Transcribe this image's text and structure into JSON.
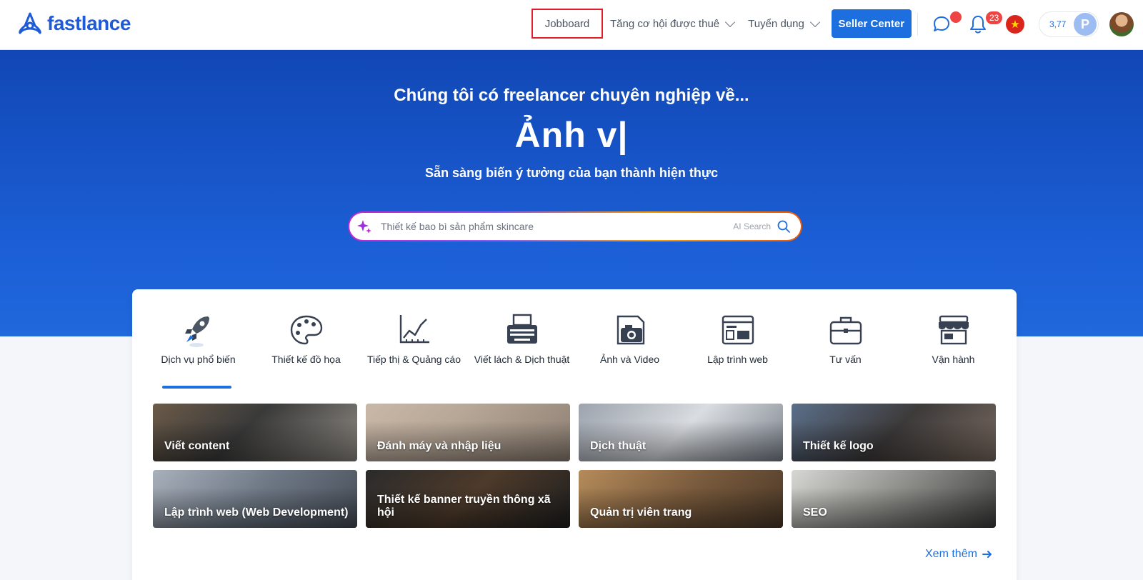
{
  "brand": {
    "name": "fastlance",
    "accent": "#1d6fe0"
  },
  "nav": {
    "jobboard": "Jobboard",
    "opportunities": "Tăng cơ hội được thuê",
    "recruitment": "Tuyển dụng",
    "seller_center": "Seller Center"
  },
  "header": {
    "notifications_count": "23",
    "points": "3,77",
    "points_avatar_letter": "P",
    "language_flag": "vietnam-flag-icon",
    "icons": [
      "chat-icon",
      "bell-icon",
      "vietnam-flag-icon",
      "avatar"
    ]
  },
  "hero": {
    "subtitle": "Chúng tôi có freelancer chuyên nghiệp về...",
    "title": "Ảnh v|",
    "tagline": "Sẵn sàng biến ý tưởng của bạn thành hiện thực"
  },
  "search": {
    "placeholder": "Thiết kế bao bì sản phẩm skincare",
    "ai_label": "AI Search"
  },
  "categories": [
    {
      "label": "Dịch vụ phổ biến",
      "icon": "rocket-icon",
      "active": true
    },
    {
      "label": "Thiết kế đồ họa",
      "icon": "palette-icon",
      "active": false
    },
    {
      "label": "Tiếp thị & Quảng cáo",
      "icon": "chart-icon",
      "active": false
    },
    {
      "label": "Viết lách & Dịch thuật",
      "icon": "typewriter-icon",
      "active": false
    },
    {
      "label": "Ảnh và Video",
      "icon": "camera-icon",
      "active": false
    },
    {
      "label": "Lập trình web",
      "icon": "browser-icon",
      "active": false
    },
    {
      "label": "Tư vấn",
      "icon": "briefcase-icon",
      "active": false
    },
    {
      "label": "Vận hành",
      "icon": "store-icon",
      "active": false
    }
  ],
  "services": [
    {
      "label": "Viết content"
    },
    {
      "label": "Đánh máy và nhập liệu"
    },
    {
      "label": "Dịch thuật"
    },
    {
      "label": "Thiết kế logo"
    },
    {
      "label": "Lập trình web (Web Development)"
    },
    {
      "label": "Thiết kế banner truyền thông xã hội"
    },
    {
      "label": "Quản trị viên trang"
    },
    {
      "label": "SEO"
    }
  ],
  "more_link": "Xem thêm"
}
